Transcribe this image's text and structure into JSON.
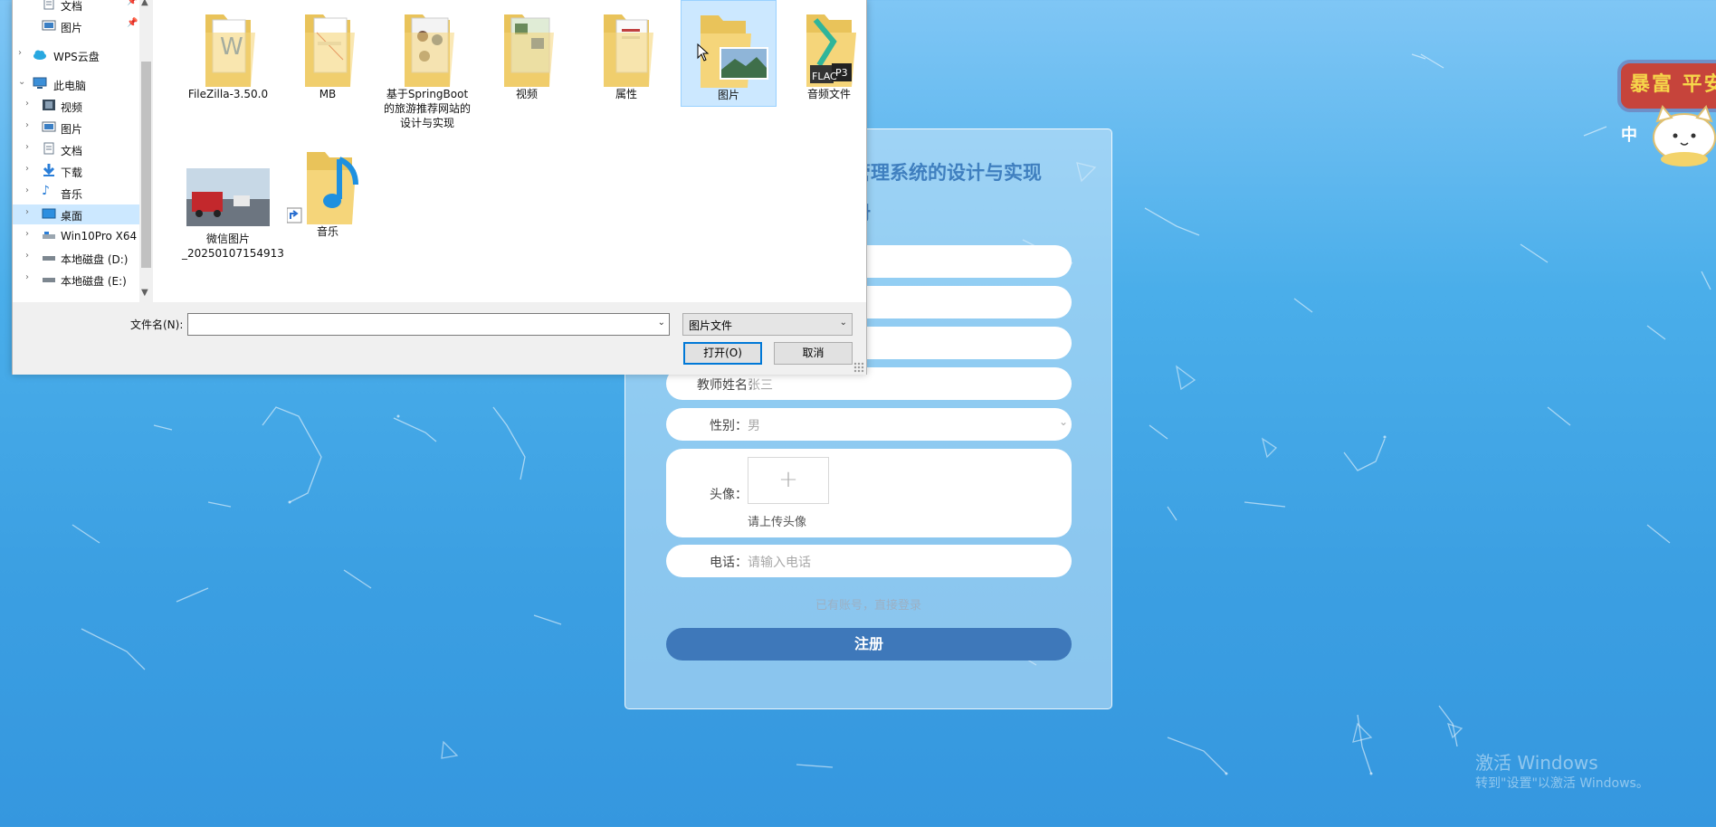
{
  "form": {
    "title": "管理系统的设计与实现",
    "subtitle": "册",
    "fields": [
      {
        "label": "教师姓名：",
        "value": "张三"
      },
      {
        "label": "性别：",
        "value": "男"
      },
      {
        "label": "头像：",
        "hint": "请上传头像"
      },
      {
        "label": "电话：",
        "placeholder": "请输入电话"
      }
    ],
    "login_link": "已有账号，直接登录",
    "register_button": "注册"
  },
  "dialog": {
    "nav": [
      {
        "label": "文档",
        "icon": "document-icon",
        "pinned": true
      },
      {
        "label": "图片",
        "icon": "pictures-icon",
        "pinned": true
      },
      {
        "label": "WPS云盘",
        "icon": "cloud-icon"
      },
      {
        "label": "此电脑",
        "icon": "computer-icon",
        "expanded": true
      },
      {
        "label": "视频",
        "icon": "video-icon"
      },
      {
        "label": "图片",
        "icon": "pictures-icon"
      },
      {
        "label": "文档",
        "icon": "document-icon"
      },
      {
        "label": "下载",
        "icon": "download-icon"
      },
      {
        "label": "音乐",
        "icon": "music-icon"
      },
      {
        "label": "桌面",
        "icon": "desktop-icon",
        "selected": true
      },
      {
        "label": "Win10Pro X64",
        "icon": "drive-icon"
      },
      {
        "label": "本地磁盘 (D:)",
        "icon": "drive-icon"
      },
      {
        "label": "本地磁盘 (E:)",
        "icon": "drive-icon"
      }
    ],
    "files": [
      {
        "name": "FileZilla-3.50.0"
      },
      {
        "name": "MB"
      },
      {
        "name": "基于SpringBoot的旅游推荐网站的设计与实现"
      },
      {
        "name": "视频"
      },
      {
        "name": "属性"
      },
      {
        "name": "图片",
        "selected": true
      },
      {
        "name": "音频文件"
      },
      {
        "name": "微信图片_20250107154913"
      },
      {
        "name": "音乐"
      }
    ],
    "filename_label": "文件名(N):",
    "filename_value": "",
    "file_type": "图片文件",
    "open_button": "打开(O)",
    "cancel_button": "取消"
  },
  "badge": {
    "text": "暴富 平安",
    "lang": "中"
  },
  "watermark": {
    "line1": "激活 Windows",
    "line2": "转到\"设置\"以激活 Windows。"
  },
  "colors": {
    "accent": "#3e78ba",
    "title": "#3f7fbf",
    "selection": "#cce8ff",
    "dialog_focus": "#0078d7"
  }
}
